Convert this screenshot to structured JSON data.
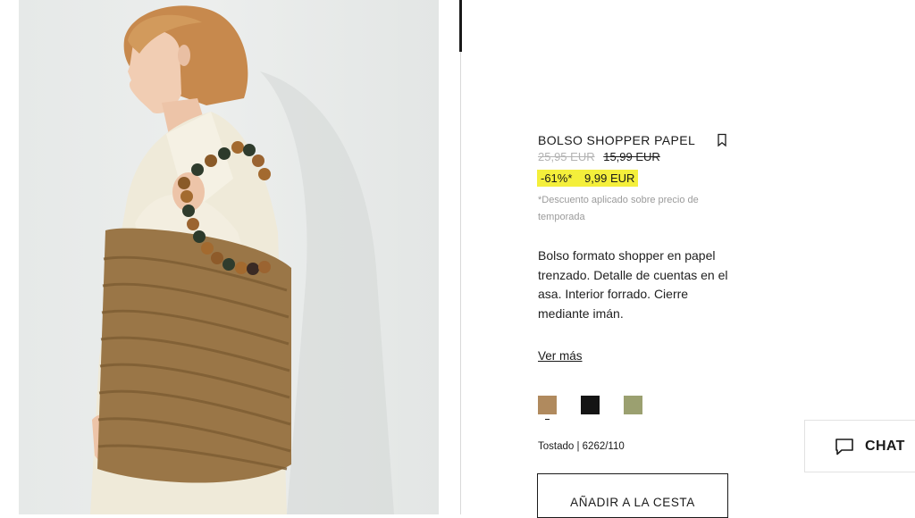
{
  "product": {
    "image_alt": "Modelo con bolso shopper de papel trenzado",
    "title": "BOLSO SHOPPER PAPEL",
    "price_original": "25,95 EUR",
    "price_previous": "15,99 EUR",
    "discount": "-61%*",
    "price_current": "9,99 EUR",
    "discount_note": "*Descuento aplicado sobre precio de temporada",
    "description": "Bolso formato shopper en papel trenzado. Detalle de cuentas en el asa. Interior forrado. Cierre mediante imán.",
    "more_link": "Ver más",
    "colors": [
      {
        "name": "Tostado",
        "hex": "#b08a5e",
        "selected": true
      },
      {
        "name": "Negro",
        "hex": "#141414",
        "selected": false
      },
      {
        "name": "Kaki",
        "hex": "#9ba070",
        "selected": false
      }
    ],
    "selected_color_info": "Tostado | 6262/110",
    "add_to_cart": "AÑADIR A LA CESTA"
  },
  "chat": {
    "label": "CHAT",
    "icon": "chat-bubble-icon"
  },
  "colors": {
    "promo_highlight": "#f4ef3b",
    "text": "#1a1a1a",
    "muted": "#b3b3b3"
  }
}
